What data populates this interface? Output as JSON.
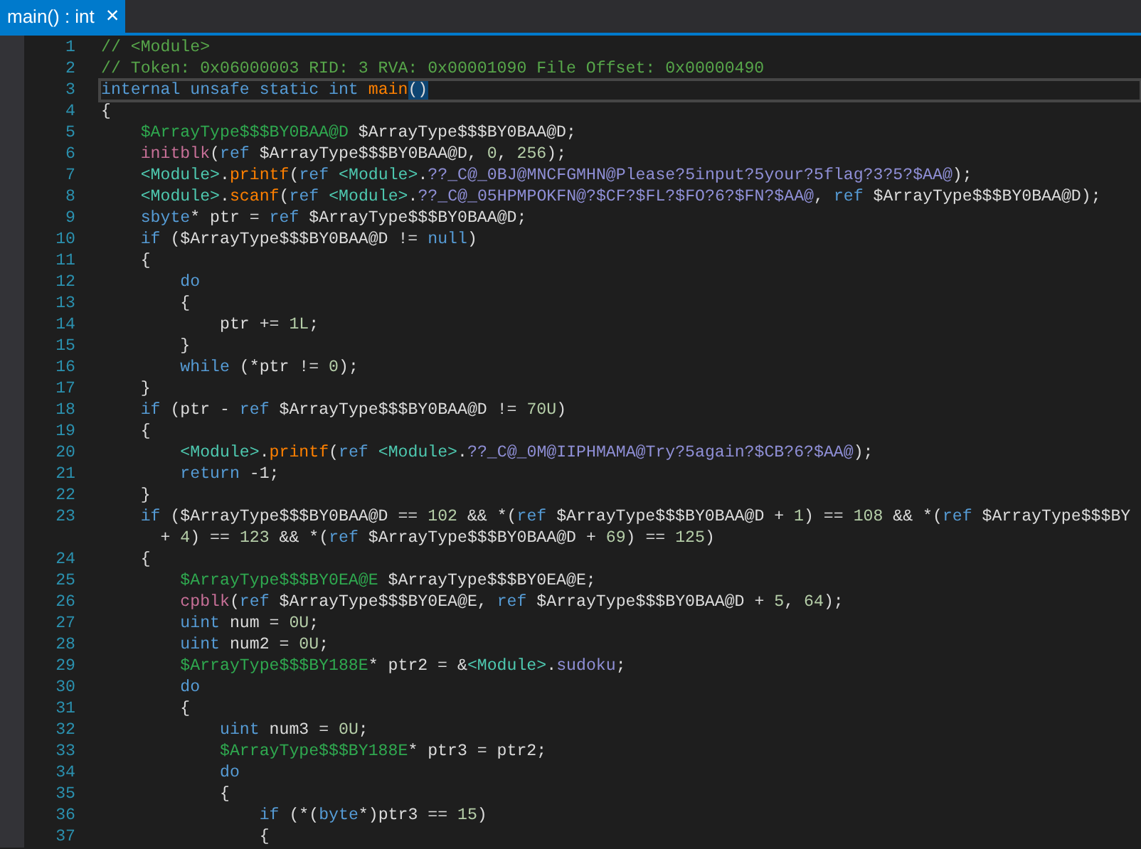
{
  "tabs": [
    {
      "label": "main() : int",
      "close": "×",
      "selected": true
    }
  ],
  "editor": {
    "lines": [
      {
        "number": "1",
        "selected": false,
        "tokens": [
          {
            "kind": "comment",
            "text": "// <Module>"
          }
        ]
      },
      {
        "number": "2",
        "selected": false,
        "tokens": [
          {
            "kind": "comment",
            "text": "// Token: 0x06000003 RID: 3 RVA: 0x00001090 File Offset: 0x00000490"
          }
        ]
      },
      {
        "number": "3",
        "selected": true,
        "tokens": [
          {
            "kind": "keyword",
            "text": "internal unsafe static int "
          },
          {
            "kind": "method",
            "text": "main"
          },
          {
            "kind": "brace-match",
            "text": "()"
          }
        ]
      },
      {
        "number": "4",
        "selected": false,
        "tokens": [
          {
            "kind": "plain",
            "text": "{"
          }
        ]
      },
      {
        "number": "5",
        "selected": false,
        "tokens": [
          {
            "kind": "valuetype",
            "text": "    $ArrayType$$$BY0BAA@D"
          },
          {
            "kind": "plain",
            "text": " $ArrayType$$$BY0BAA@D;"
          }
        ]
      },
      {
        "number": "6",
        "selected": false,
        "tokens": [
          {
            "kind": "intrinsic",
            "text": "    initblk"
          },
          {
            "kind": "plain",
            "text": "("
          },
          {
            "kind": "keyword",
            "text": "ref"
          },
          {
            "kind": "plain",
            "text": " $ArrayType$$$BY0BAA@D, "
          },
          {
            "kind": "number",
            "text": "0"
          },
          {
            "kind": "plain",
            "text": ", "
          },
          {
            "kind": "number",
            "text": "256"
          },
          {
            "kind": "plain",
            "text": ");"
          }
        ]
      },
      {
        "number": "7",
        "selected": false,
        "tokens": [
          {
            "kind": "type",
            "text": "    <Module>"
          },
          {
            "kind": "plain",
            "text": "."
          },
          {
            "kind": "method",
            "text": "printf"
          },
          {
            "kind": "plain",
            "text": "("
          },
          {
            "kind": "keyword",
            "text": "ref "
          },
          {
            "kind": "type",
            "text": "<Module>"
          },
          {
            "kind": "plain",
            "text": "."
          },
          {
            "kind": "field",
            "text": "??_C@_0BJ@MNCFGMHN@Please?5input?5your?5flag?3?5?$AA@"
          },
          {
            "kind": "plain",
            "text": ");"
          }
        ]
      },
      {
        "number": "8",
        "selected": false,
        "tokens": [
          {
            "kind": "type",
            "text": "    <Module>"
          },
          {
            "kind": "plain",
            "text": "."
          },
          {
            "kind": "method",
            "text": "scanf"
          },
          {
            "kind": "plain",
            "text": "("
          },
          {
            "kind": "keyword",
            "text": "ref "
          },
          {
            "kind": "type",
            "text": "<Module>"
          },
          {
            "kind": "plain",
            "text": "."
          },
          {
            "kind": "field",
            "text": "??_C@_05HPMPOKFN@?$CF?$FL?$FO?6?$FN?$AA@"
          },
          {
            "kind": "plain",
            "text": ", "
          },
          {
            "kind": "keyword",
            "text": "ref"
          },
          {
            "kind": "plain",
            "text": " $ArrayType$$$BY0BAA@D);"
          }
        ]
      },
      {
        "number": "9",
        "selected": false,
        "tokens": [
          {
            "kind": "keyword",
            "text": "    sbyte"
          },
          {
            "kind": "plain",
            "text": "* ptr = "
          },
          {
            "kind": "keyword",
            "text": "ref"
          },
          {
            "kind": "plain",
            "text": " $ArrayType$$$BY0BAA@D;"
          }
        ]
      },
      {
        "number": "10",
        "selected": false,
        "tokens": [
          {
            "kind": "keyword",
            "text": "    if"
          },
          {
            "kind": "plain",
            "text": " ($ArrayType$$$BY0BAA@D != "
          },
          {
            "kind": "keyword",
            "text": "null"
          },
          {
            "kind": "plain",
            "text": ")"
          }
        ]
      },
      {
        "number": "11",
        "selected": false,
        "tokens": [
          {
            "kind": "plain",
            "text": "    {"
          }
        ]
      },
      {
        "number": "12",
        "selected": false,
        "tokens": [
          {
            "kind": "keyword",
            "text": "        do"
          }
        ]
      },
      {
        "number": "13",
        "selected": false,
        "tokens": [
          {
            "kind": "plain",
            "text": "        {"
          }
        ]
      },
      {
        "number": "14",
        "selected": false,
        "tokens": [
          {
            "kind": "plain",
            "text": "            ptr += "
          },
          {
            "kind": "number",
            "text": "1L"
          },
          {
            "kind": "plain",
            "text": ";"
          }
        ]
      },
      {
        "number": "15",
        "selected": false,
        "tokens": [
          {
            "kind": "plain",
            "text": "        }"
          }
        ]
      },
      {
        "number": "16",
        "selected": false,
        "tokens": [
          {
            "kind": "keyword",
            "text": "        while"
          },
          {
            "kind": "plain",
            "text": " (*ptr != "
          },
          {
            "kind": "number",
            "text": "0"
          },
          {
            "kind": "plain",
            "text": ");"
          }
        ]
      },
      {
        "number": "17",
        "selected": false,
        "tokens": [
          {
            "kind": "plain",
            "text": "    }"
          }
        ]
      },
      {
        "number": "18",
        "selected": false,
        "tokens": [
          {
            "kind": "keyword",
            "text": "    if"
          },
          {
            "kind": "plain",
            "text": " (ptr - "
          },
          {
            "kind": "keyword",
            "text": "ref"
          },
          {
            "kind": "plain",
            "text": " $ArrayType$$$BY0BAA@D != "
          },
          {
            "kind": "number",
            "text": "70U"
          },
          {
            "kind": "plain",
            "text": ")"
          }
        ]
      },
      {
        "number": "19",
        "selected": false,
        "tokens": [
          {
            "kind": "plain",
            "text": "    {"
          }
        ]
      },
      {
        "number": "20",
        "selected": false,
        "tokens": [
          {
            "kind": "type",
            "text": "        <Module>"
          },
          {
            "kind": "plain",
            "text": "."
          },
          {
            "kind": "method",
            "text": "printf"
          },
          {
            "kind": "plain",
            "text": "("
          },
          {
            "kind": "keyword",
            "text": "ref "
          },
          {
            "kind": "type",
            "text": "<Module>"
          },
          {
            "kind": "plain",
            "text": "."
          },
          {
            "kind": "field",
            "text": "??_C@_0M@IIPHMAMA@Try?5again?$CB?6?$AA@"
          },
          {
            "kind": "plain",
            "text": ");"
          }
        ]
      },
      {
        "number": "21",
        "selected": false,
        "tokens": [
          {
            "kind": "keyword",
            "text": "        return"
          },
          {
            "kind": "plain",
            "text": " -1;"
          }
        ]
      },
      {
        "number": "22",
        "selected": false,
        "tokens": [
          {
            "kind": "plain",
            "text": "    }"
          }
        ]
      },
      {
        "number": "23",
        "selected": false,
        "tokens": [
          {
            "kind": "keyword",
            "text": "    if"
          },
          {
            "kind": "plain",
            "text": " ($ArrayType$$$BY0BAA@D == "
          },
          {
            "kind": "number",
            "text": "102"
          },
          {
            "kind": "plain",
            "text": " && *("
          },
          {
            "kind": "keyword",
            "text": "ref"
          },
          {
            "kind": "plain",
            "text": " $ArrayType$$$BY0BAA@D + "
          },
          {
            "kind": "number",
            "text": "1"
          },
          {
            "kind": "plain",
            "text": ") == "
          },
          {
            "kind": "number",
            "text": "108"
          },
          {
            "kind": "plain",
            "text": " && *("
          },
          {
            "kind": "keyword",
            "text": "ref"
          },
          {
            "kind": "plain",
            "text": " $ArrayType$$$BY"
          }
        ],
        "continuation": [
          {
            "kind": "plain",
            "text": "      + "
          },
          {
            "kind": "number",
            "text": "4"
          },
          {
            "kind": "plain",
            "text": ") == "
          },
          {
            "kind": "number",
            "text": "123"
          },
          {
            "kind": "plain",
            "text": " && *("
          },
          {
            "kind": "keyword",
            "text": "ref"
          },
          {
            "kind": "plain",
            "text": " $ArrayType$$$BY0BAA@D + "
          },
          {
            "kind": "number",
            "text": "69"
          },
          {
            "kind": "plain",
            "text": ") == "
          },
          {
            "kind": "number",
            "text": "125"
          },
          {
            "kind": "plain",
            "text": ")"
          }
        ]
      },
      {
        "number": "24",
        "selected": false,
        "tokens": [
          {
            "kind": "plain",
            "text": "    {"
          }
        ]
      },
      {
        "number": "25",
        "selected": false,
        "tokens": [
          {
            "kind": "valuetype",
            "text": "        $ArrayType$$$BY0EA@E"
          },
          {
            "kind": "plain",
            "text": " $ArrayType$$$BY0EA@E;"
          }
        ]
      },
      {
        "number": "26",
        "selected": false,
        "tokens": [
          {
            "kind": "intrinsic",
            "text": "        cpblk"
          },
          {
            "kind": "plain",
            "text": "("
          },
          {
            "kind": "keyword",
            "text": "ref"
          },
          {
            "kind": "plain",
            "text": " $ArrayType$$$BY0EA@E, "
          },
          {
            "kind": "keyword",
            "text": "ref"
          },
          {
            "kind": "plain",
            "text": " $ArrayType$$$BY0BAA@D + "
          },
          {
            "kind": "number",
            "text": "5"
          },
          {
            "kind": "plain",
            "text": ", "
          },
          {
            "kind": "number",
            "text": "64"
          },
          {
            "kind": "plain",
            "text": ");"
          }
        ]
      },
      {
        "number": "27",
        "selected": false,
        "tokens": [
          {
            "kind": "keyword",
            "text": "        uint"
          },
          {
            "kind": "plain",
            "text": " num = "
          },
          {
            "kind": "number",
            "text": "0U"
          },
          {
            "kind": "plain",
            "text": ";"
          }
        ]
      },
      {
        "number": "28",
        "selected": false,
        "tokens": [
          {
            "kind": "keyword",
            "text": "        uint"
          },
          {
            "kind": "plain",
            "text": " num2 = "
          },
          {
            "kind": "number",
            "text": "0U"
          },
          {
            "kind": "plain",
            "text": ";"
          }
        ]
      },
      {
        "number": "29",
        "selected": false,
        "tokens": [
          {
            "kind": "valuetype",
            "text": "        $ArrayType$$$BY188E"
          },
          {
            "kind": "plain",
            "text": "* ptr2 = &"
          },
          {
            "kind": "type",
            "text": "<Module>"
          },
          {
            "kind": "plain",
            "text": "."
          },
          {
            "kind": "field",
            "text": "sudoku"
          },
          {
            "kind": "plain",
            "text": ";"
          }
        ]
      },
      {
        "number": "30",
        "selected": false,
        "tokens": [
          {
            "kind": "keyword",
            "text": "        do"
          }
        ]
      },
      {
        "number": "31",
        "selected": false,
        "tokens": [
          {
            "kind": "plain",
            "text": "        {"
          }
        ]
      },
      {
        "number": "32",
        "selected": false,
        "tokens": [
          {
            "kind": "keyword",
            "text": "            uint"
          },
          {
            "kind": "plain",
            "text": " num3 = "
          },
          {
            "kind": "number",
            "text": "0U"
          },
          {
            "kind": "plain",
            "text": ";"
          }
        ]
      },
      {
        "number": "33",
        "selected": false,
        "tokens": [
          {
            "kind": "valuetype",
            "text": "            $ArrayType$$$BY188E"
          },
          {
            "kind": "plain",
            "text": "* ptr3 = ptr2;"
          }
        ]
      },
      {
        "number": "34",
        "selected": false,
        "tokens": [
          {
            "kind": "keyword",
            "text": "            do"
          }
        ]
      },
      {
        "number": "35",
        "selected": false,
        "tokens": [
          {
            "kind": "plain",
            "text": "            {"
          }
        ]
      },
      {
        "number": "36",
        "selected": false,
        "tokens": [
          {
            "kind": "keyword",
            "text": "                if"
          },
          {
            "kind": "plain",
            "text": " (*("
          },
          {
            "kind": "keyword",
            "text": "byte"
          },
          {
            "kind": "plain",
            "text": "*)ptr3 == "
          },
          {
            "kind": "number",
            "text": "15"
          },
          {
            "kind": "plain",
            "text": ")"
          }
        ]
      },
      {
        "number": "37",
        "selected": false,
        "tokens": [
          {
            "kind": "plain",
            "text": "                {"
          }
        ]
      }
    ]
  }
}
